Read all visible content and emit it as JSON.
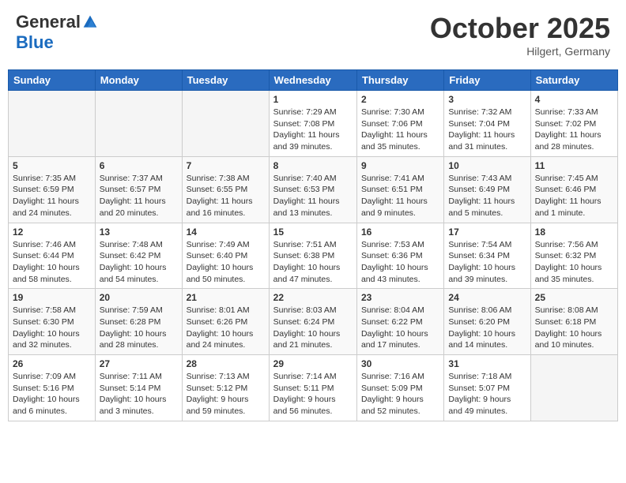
{
  "header": {
    "logo_general": "General",
    "logo_blue": "Blue",
    "month_title": "October 2025",
    "location": "Hilgert, Germany"
  },
  "weekdays": [
    "Sunday",
    "Monday",
    "Tuesday",
    "Wednesday",
    "Thursday",
    "Friday",
    "Saturday"
  ],
  "weeks": [
    [
      {
        "day": "",
        "info": ""
      },
      {
        "day": "",
        "info": ""
      },
      {
        "day": "",
        "info": ""
      },
      {
        "day": "1",
        "info": "Sunrise: 7:29 AM\nSunset: 7:08 PM\nDaylight: 11 hours\nand 39 minutes."
      },
      {
        "day": "2",
        "info": "Sunrise: 7:30 AM\nSunset: 7:06 PM\nDaylight: 11 hours\nand 35 minutes."
      },
      {
        "day": "3",
        "info": "Sunrise: 7:32 AM\nSunset: 7:04 PM\nDaylight: 11 hours\nand 31 minutes."
      },
      {
        "day": "4",
        "info": "Sunrise: 7:33 AM\nSunset: 7:02 PM\nDaylight: 11 hours\nand 28 minutes."
      }
    ],
    [
      {
        "day": "5",
        "info": "Sunrise: 7:35 AM\nSunset: 6:59 PM\nDaylight: 11 hours\nand 24 minutes."
      },
      {
        "day": "6",
        "info": "Sunrise: 7:37 AM\nSunset: 6:57 PM\nDaylight: 11 hours\nand 20 minutes."
      },
      {
        "day": "7",
        "info": "Sunrise: 7:38 AM\nSunset: 6:55 PM\nDaylight: 11 hours\nand 16 minutes."
      },
      {
        "day": "8",
        "info": "Sunrise: 7:40 AM\nSunset: 6:53 PM\nDaylight: 11 hours\nand 13 minutes."
      },
      {
        "day": "9",
        "info": "Sunrise: 7:41 AM\nSunset: 6:51 PM\nDaylight: 11 hours\nand 9 minutes."
      },
      {
        "day": "10",
        "info": "Sunrise: 7:43 AM\nSunset: 6:49 PM\nDaylight: 11 hours\nand 5 minutes."
      },
      {
        "day": "11",
        "info": "Sunrise: 7:45 AM\nSunset: 6:46 PM\nDaylight: 11 hours\nand 1 minute."
      }
    ],
    [
      {
        "day": "12",
        "info": "Sunrise: 7:46 AM\nSunset: 6:44 PM\nDaylight: 10 hours\nand 58 minutes."
      },
      {
        "day": "13",
        "info": "Sunrise: 7:48 AM\nSunset: 6:42 PM\nDaylight: 10 hours\nand 54 minutes."
      },
      {
        "day": "14",
        "info": "Sunrise: 7:49 AM\nSunset: 6:40 PM\nDaylight: 10 hours\nand 50 minutes."
      },
      {
        "day": "15",
        "info": "Sunrise: 7:51 AM\nSunset: 6:38 PM\nDaylight: 10 hours\nand 47 minutes."
      },
      {
        "day": "16",
        "info": "Sunrise: 7:53 AM\nSunset: 6:36 PM\nDaylight: 10 hours\nand 43 minutes."
      },
      {
        "day": "17",
        "info": "Sunrise: 7:54 AM\nSunset: 6:34 PM\nDaylight: 10 hours\nand 39 minutes."
      },
      {
        "day": "18",
        "info": "Sunrise: 7:56 AM\nSunset: 6:32 PM\nDaylight: 10 hours\nand 35 minutes."
      }
    ],
    [
      {
        "day": "19",
        "info": "Sunrise: 7:58 AM\nSunset: 6:30 PM\nDaylight: 10 hours\nand 32 minutes."
      },
      {
        "day": "20",
        "info": "Sunrise: 7:59 AM\nSunset: 6:28 PM\nDaylight: 10 hours\nand 28 minutes."
      },
      {
        "day": "21",
        "info": "Sunrise: 8:01 AM\nSunset: 6:26 PM\nDaylight: 10 hours\nand 24 minutes."
      },
      {
        "day": "22",
        "info": "Sunrise: 8:03 AM\nSunset: 6:24 PM\nDaylight: 10 hours\nand 21 minutes."
      },
      {
        "day": "23",
        "info": "Sunrise: 8:04 AM\nSunset: 6:22 PM\nDaylight: 10 hours\nand 17 minutes."
      },
      {
        "day": "24",
        "info": "Sunrise: 8:06 AM\nSunset: 6:20 PM\nDaylight: 10 hours\nand 14 minutes."
      },
      {
        "day": "25",
        "info": "Sunrise: 8:08 AM\nSunset: 6:18 PM\nDaylight: 10 hours\nand 10 minutes."
      }
    ],
    [
      {
        "day": "26",
        "info": "Sunrise: 7:09 AM\nSunset: 5:16 PM\nDaylight: 10 hours\nand 6 minutes."
      },
      {
        "day": "27",
        "info": "Sunrise: 7:11 AM\nSunset: 5:14 PM\nDaylight: 10 hours\nand 3 minutes."
      },
      {
        "day": "28",
        "info": "Sunrise: 7:13 AM\nSunset: 5:12 PM\nDaylight: 9 hours\nand 59 minutes."
      },
      {
        "day": "29",
        "info": "Sunrise: 7:14 AM\nSunset: 5:11 PM\nDaylight: 9 hours\nand 56 minutes."
      },
      {
        "day": "30",
        "info": "Sunrise: 7:16 AM\nSunset: 5:09 PM\nDaylight: 9 hours\nand 52 minutes."
      },
      {
        "day": "31",
        "info": "Sunrise: 7:18 AM\nSunset: 5:07 PM\nDaylight: 9 hours\nand 49 minutes."
      },
      {
        "day": "",
        "info": ""
      }
    ]
  ]
}
